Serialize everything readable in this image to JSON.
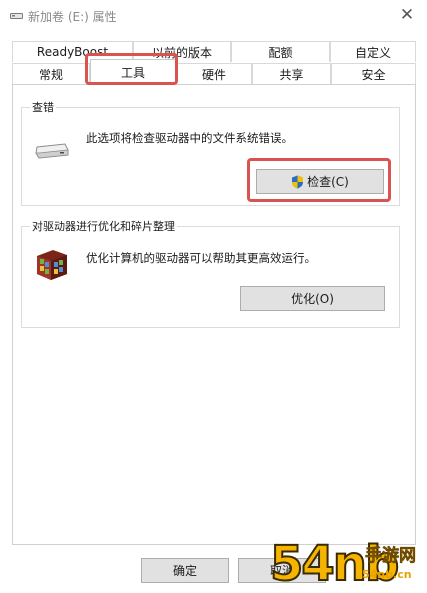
{
  "window": {
    "title": "新加卷 (E:) 属性",
    "close_glyph": "✕"
  },
  "tabs": {
    "row1": [
      "ReadyBoost",
      "以前的版本",
      "配额",
      "自定义"
    ],
    "row2": [
      "常规",
      "工具",
      "硬件",
      "共享",
      "安全"
    ],
    "selected": "工具"
  },
  "error_checking": {
    "group_title": "查错",
    "description": "此选项将检查驱动器中的文件系统错误。",
    "check_button": "检查(C)",
    "drive_icon": "drive-icon",
    "shield_icon": "uac-shield-icon"
  },
  "optimize": {
    "group_title": "对驱动器进行优化和碎片整理",
    "description": "优化计算机的驱动器可以帮助其更高效运行。",
    "optimize_button": "优化(O)",
    "defrag_icon": "defrag-icon"
  },
  "footer": {
    "ok_button": "确定",
    "cancel_button": "取消"
  },
  "watermark": {
    "number": "54nb",
    "name": "手游网",
    "url": "54nb.cn"
  },
  "colors": {
    "highlight": "#d9534f",
    "button_bg": "#e1e1e1",
    "watermark": "#f5b400"
  }
}
